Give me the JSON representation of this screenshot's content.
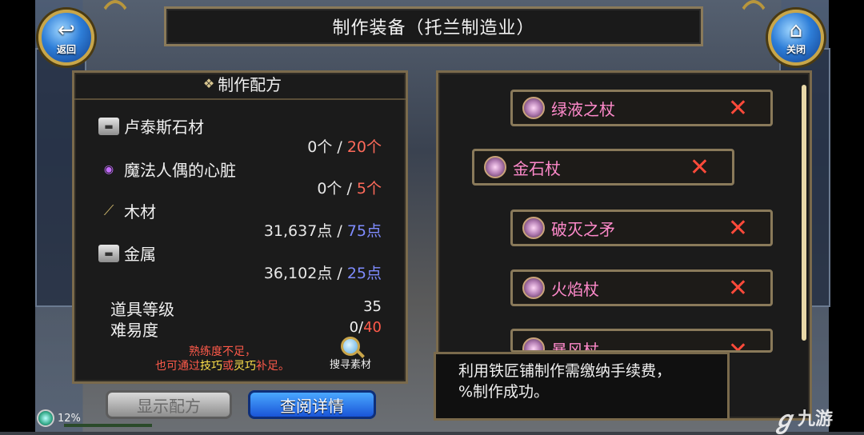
{
  "header": {
    "title": "制作装备（托兰制造业）",
    "back_label": "返回",
    "close_label": "关闭"
  },
  "recipe_panel": {
    "title": "制作配方",
    "materials": [
      {
        "name": "卢泰斯石材",
        "have": "0个",
        "sep": " / ",
        "need": "20个",
        "icon": "stone-icon"
      },
      {
        "name": "魔法人偶的心脏",
        "have": "0个",
        "sep": " / ",
        "need": "5个",
        "icon": "heart-orb-icon"
      },
      {
        "name": "木材",
        "have": "31,637点",
        "sep": " / ",
        "need": "75点",
        "icon": "wood-icon"
      },
      {
        "name": "金属",
        "have": "36,102点",
        "sep": " / ",
        "need": "25点",
        "icon": "metal-icon"
      }
    ],
    "item_level_label": "道具等级",
    "item_level_value": "35",
    "difficulty_label": "难易度",
    "difficulty_current": "0",
    "difficulty_sep": "/",
    "difficulty_max": "40",
    "warning_line1": "熟练度不足，",
    "warning_line2_pre": "也可通过",
    "warning_skill": "技巧",
    "warning_or": "或",
    "warning_spirit": "灵巧",
    "warning_line2_post": "补足。",
    "search_label": "搜寻素材"
  },
  "buttons": {
    "show_recipe": "显示配方",
    "view_details": "查阅详情"
  },
  "recipe_list": [
    {
      "name": "绿液之杖"
    },
    {
      "name": "金石杖"
    },
    {
      "name": "破灭之矛"
    },
    {
      "name": "火焰杖"
    },
    {
      "name": "暴风杖"
    }
  ],
  "message": {
    "line1": "利用铁匠铺制作需缴纳手续费，",
    "line2": "%制作成功。"
  },
  "status": {
    "percent": "12%"
  },
  "watermark": {
    "text": "九游"
  },
  "colors": {
    "need_red": "#ff6a5a",
    "need_blue": "#7f8cff",
    "item_name_pink": "#ff8acb",
    "panel_border": "#7a6a4c"
  }
}
